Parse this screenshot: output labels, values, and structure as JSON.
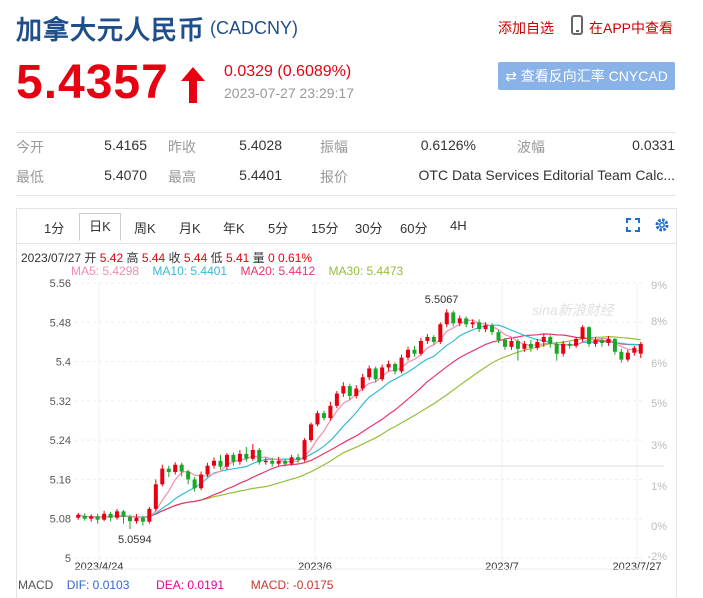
{
  "header": {
    "title": "加拿大元人民币",
    "code": "(CADCNY)",
    "add_fav": "添加自选",
    "app_link": "在APP中查看"
  },
  "quote": {
    "price": "5.4357",
    "change": "0.0329 (0.6089%)",
    "time": "2023-07-27 23:29:17",
    "reverse_btn": "⇄ 查看反向汇率 CNYCAD"
  },
  "stats": {
    "row1": [
      {
        "label": "今开",
        "value": "5.4165"
      },
      {
        "label": "昨收",
        "value": "5.4028"
      },
      {
        "label": "振幅",
        "value": "0.6126%"
      },
      {
        "label": "波幅",
        "value": "0.0331"
      }
    ],
    "row2": [
      {
        "label": "最低",
        "value": "5.4070"
      },
      {
        "label": "最高",
        "value": "5.4401"
      },
      {
        "label": "报价",
        "value": "OTC Data Services Editorial Team Calc..."
      }
    ]
  },
  "tabs": [
    "1分",
    "日K",
    "周K",
    "月K",
    "年K",
    "5分",
    "15分",
    "30分",
    "60分",
    "4H"
  ],
  "active_tab": "日K",
  "kline_info": {
    "date": "2023/07/27",
    "open_label": "开",
    "open": "5.42",
    "high_label": "高",
    "high": "5.44",
    "close_label": "收",
    "close": "5.44",
    "low_label": "低",
    "low": "5.41",
    "vol_label": "量",
    "vol": "0",
    "pct": "0.61%"
  },
  "ma_info": {
    "ma5": "MA5: 5.4298",
    "ma10": "MA10: 5.4401",
    "ma20": "MA20: 5.4412",
    "ma30": "MA30: 5.4473"
  },
  "macd_info": {
    "label": "MACD",
    "dif": "DIF: 0.0103",
    "dea": "DEA: 0.0191",
    "macd": "MACD: -0.0175"
  },
  "colors": {
    "up": "#e60012",
    "down": "#1aa626",
    "ma5": "#f28cb0",
    "ma10": "#33bbd8",
    "ma20": "#e8356a",
    "ma30": "#96bf3a",
    "brand": "#1f4e8c"
  },
  "chart_data": {
    "type": "candlestick",
    "title": "",
    "y_ticks": [
      "5.56",
      "5.48",
      "5.4",
      "5.32",
      "5.24",
      "5.16",
      "5.08",
      "5"
    ],
    "pct_ticks": [
      "9%",
      "8%",
      "6%",
      "5%",
      "3%",
      "1%",
      "0%",
      "-2%"
    ],
    "x_ticks": [
      "2023/4/24",
      "2023/6",
      "2023/7",
      "2023/7/27"
    ],
    "ylim": [
      5.0,
      5.56
    ],
    "annotations": [
      {
        "text": "5.5067",
        "value": 5.5067
      },
      {
        "text": "5.0594",
        "value": 5.0594
      }
    ],
    "watermark": "sina新浪财经",
    "candles": [
      [
        5.082,
        5.088,
        5.078,
        5.092
      ],
      [
        5.086,
        5.08,
        5.076,
        5.091
      ],
      [
        5.08,
        5.085,
        5.074,
        5.089
      ],
      [
        5.085,
        5.078,
        5.07,
        5.09
      ],
      [
        5.078,
        5.09,
        5.075,
        5.096
      ],
      [
        5.09,
        5.082,
        5.075,
        5.094
      ],
      [
        5.082,
        5.095,
        5.078,
        5.1
      ],
      [
        5.095,
        5.084,
        5.07,
        5.098
      ],
      [
        5.084,
        5.075,
        5.059,
        5.088
      ],
      [
        5.075,
        5.082,
        5.07,
        5.09
      ],
      [
        5.082,
        5.074,
        5.066,
        5.086
      ],
      [
        5.074,
        5.1,
        5.07,
        5.104
      ],
      [
        5.1,
        5.15,
        5.095,
        5.16
      ],
      [
        5.15,
        5.182,
        5.146,
        5.19
      ],
      [
        5.182,
        5.175,
        5.165,
        5.188
      ],
      [
        5.175,
        5.19,
        5.17,
        5.195
      ],
      [
        5.19,
        5.176,
        5.166,
        5.194
      ],
      [
        5.176,
        5.16,
        5.15,
        5.18
      ],
      [
        5.16,
        5.142,
        5.135,
        5.165
      ],
      [
        5.142,
        5.17,
        5.138,
        5.176
      ],
      [
        5.17,
        5.188,
        5.165,
        5.194
      ],
      [
        5.188,
        5.198,
        5.182,
        5.205
      ],
      [
        5.198,
        5.186,
        5.18,
        5.21
      ],
      [
        5.186,
        5.21,
        5.18,
        5.214
      ],
      [
        5.21,
        5.196,
        5.188,
        5.215
      ],
      [
        5.196,
        5.212,
        5.19,
        5.22
      ],
      [
        5.212,
        5.202,
        5.196,
        5.226
      ],
      [
        5.202,
        5.22,
        5.198,
        5.232
      ],
      [
        5.22,
        5.195,
        5.19,
        5.224
      ],
      [
        5.195,
        5.198,
        5.19,
        5.204
      ],
      [
        5.198,
        5.192,
        5.186,
        5.204
      ],
      [
        5.192,
        5.198,
        5.188,
        5.206
      ],
      [
        5.198,
        5.192,
        5.186,
        5.202
      ],
      [
        5.192,
        5.205,
        5.188,
        5.21
      ],
      [
        5.205,
        5.2,
        5.194,
        5.212
      ],
      [
        5.2,
        5.24,
        5.196,
        5.244
      ],
      [
        5.24,
        5.272,
        5.236,
        5.276
      ],
      [
        5.272,
        5.295,
        5.268,
        5.3
      ],
      [
        5.295,
        5.285,
        5.28,
        5.3
      ],
      [
        5.285,
        5.31,
        5.28,
        5.318
      ],
      [
        5.31,
        5.335,
        5.305,
        5.34
      ],
      [
        5.335,
        5.35,
        5.328,
        5.358
      ],
      [
        5.35,
        5.33,
        5.322,
        5.355
      ],
      [
        5.33,
        5.345,
        5.325,
        5.352
      ],
      [
        5.345,
        5.368,
        5.34,
        5.375
      ],
      [
        5.368,
        5.386,
        5.362,
        5.392
      ],
      [
        5.386,
        5.364,
        5.358,
        5.39
      ],
      [
        5.364,
        5.388,
        5.36,
        5.394
      ],
      [
        5.388,
        5.395,
        5.38,
        5.402
      ],
      [
        5.395,
        5.38,
        5.374,
        5.398
      ],
      [
        5.38,
        5.408,
        5.376,
        5.414
      ],
      [
        5.408,
        5.424,
        5.402,
        5.43
      ],
      [
        5.424,
        5.416,
        5.41,
        5.432
      ],
      [
        5.416,
        5.442,
        5.412,
        5.448
      ],
      [
        5.442,
        5.45,
        5.436,
        5.456
      ],
      [
        5.45,
        5.44,
        5.434,
        5.454
      ],
      [
        5.44,
        5.476,
        5.436,
        5.48
      ],
      [
        5.476,
        5.5,
        5.47,
        5.5067
      ],
      [
        5.5,
        5.478,
        5.472,
        5.504
      ],
      [
        5.478,
        5.488,
        5.472,
        5.494
      ],
      [
        5.488,
        5.476,
        5.47,
        5.492
      ],
      [
        5.476,
        5.48,
        5.468,
        5.486
      ],
      [
        5.48,
        5.466,
        5.46,
        5.486
      ],
      [
        5.466,
        5.474,
        5.46,
        5.48
      ],
      [
        5.474,
        5.46,
        5.454,
        5.478
      ],
      [
        5.46,
        5.444,
        5.438,
        5.464
      ],
      [
        5.444,
        5.43,
        5.424,
        5.448
      ],
      [
        5.43,
        5.442,
        5.424,
        5.448
      ],
      [
        5.442,
        5.426,
        5.402,
        5.446
      ],
      [
        5.426,
        5.436,
        5.42,
        5.442
      ],
      [
        5.436,
        5.428,
        5.42,
        5.444
      ],
      [
        5.428,
        5.44,
        5.424,
        5.446
      ],
      [
        5.44,
        5.45,
        5.43,
        5.456
      ],
      [
        5.45,
        5.436,
        5.428,
        5.454
      ],
      [
        5.436,
        5.416,
        5.402,
        5.44
      ],
      [
        5.416,
        5.436,
        5.41,
        5.442
      ],
      [
        5.436,
        5.432,
        5.426,
        5.44
      ],
      [
        5.432,
        5.446,
        5.428,
        5.45
      ],
      [
        5.446,
        5.47,
        5.44,
        5.474
      ],
      [
        5.47,
        5.436,
        5.43,
        5.472
      ],
      [
        5.436,
        5.444,
        5.43,
        5.45
      ],
      [
        5.444,
        5.438,
        5.43,
        5.448
      ],
      [
        5.438,
        5.446,
        5.432,
        5.452
      ],
      [
        5.446,
        5.42,
        5.414,
        5.448
      ],
      [
        5.42,
        5.404,
        5.398,
        5.426
      ],
      [
        5.404,
        5.418,
        5.4,
        5.424
      ],
      [
        5.418,
        5.428,
        5.412,
        5.432
      ],
      [
        5.416,
        5.436,
        5.407,
        5.44
      ]
    ]
  }
}
